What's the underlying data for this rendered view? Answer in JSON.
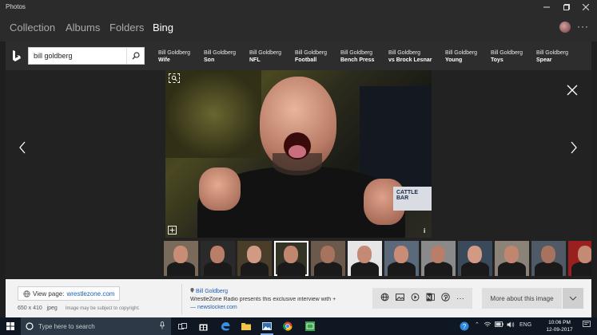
{
  "window": {
    "title": "Photos"
  },
  "nav": {
    "tabs": [
      {
        "label": "Collection"
      },
      {
        "label": "Albums"
      },
      {
        "label": "Folders"
      },
      {
        "label": "Bing"
      }
    ],
    "active_tab": "Bing"
  },
  "bing": {
    "search_value": "bill goldberg",
    "related": [
      {
        "line1": "Bill Goldberg",
        "line2": "Wife"
      },
      {
        "line1": "Bill Goldberg",
        "line2": "Son"
      },
      {
        "line1": "Bill Goldberg",
        "line2": "NFL"
      },
      {
        "line1": "Bill Goldberg",
        "line2": "Football"
      },
      {
        "line1": "Bill Goldberg",
        "line2": "Bench Press"
      },
      {
        "line1": "Bill Goldberg",
        "line2": "vs Brock Lesnar"
      },
      {
        "line1": "Bill Goldberg",
        "line2": "Young"
      },
      {
        "line1": "Bill Goldberg",
        "line2": "Toys"
      },
      {
        "line1": "Bill Goldberg",
        "line2": "Spear"
      }
    ]
  },
  "viewer": {
    "info_label": "i",
    "badge_text": "CATTLE BAR",
    "thumbnail_count": 12,
    "selected_thumbnail": 3
  },
  "infobar": {
    "view_page_label": "View page:",
    "view_page_link": "wrestlezone.com",
    "dimensions": "650 x 410",
    "format": "jpeg",
    "copyright": "Image may be subject to copyright.",
    "source_name": "Bill Goldberg",
    "source_desc": "WrestleZone Radio presents this exclusive interview with",
    "source_domain": "— newslocker.com",
    "more_about": "More about this image"
  },
  "taskbar": {
    "search_placeholder": "Type here to search",
    "language": "ENG",
    "time": "10:06 PM",
    "date": "12-09-2017"
  },
  "colors": {
    "nav_bg": "#2b2b2b",
    "viewer_bg": "#222222",
    "infobar_bg": "#f2f2f2",
    "link": "#1a5fb4",
    "taskbar_bg": "#0f1722"
  }
}
